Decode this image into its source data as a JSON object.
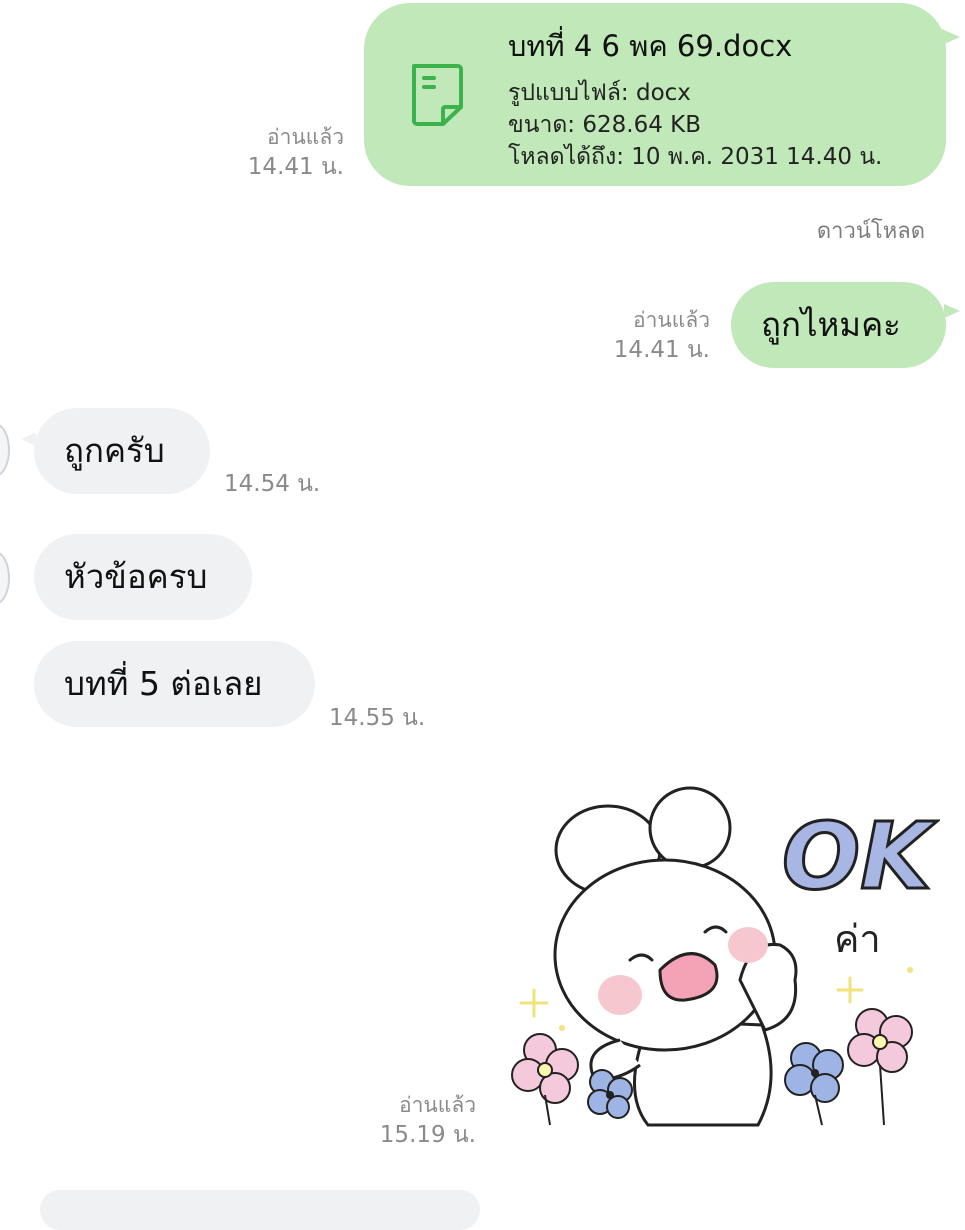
{
  "messages": {
    "file": {
      "name": "บทที่ 4 6 พค 69.docx",
      "type_line": "รูปแบบไฟล์: docx",
      "size_line": "ขนาด: 628.64 KB",
      "expiry_line": "โหลดได้ถึง: 10 พ.ค. 2031 14.40 น.",
      "read": "อ่านแล้ว",
      "time": "14.41 น.",
      "download_label": "ดาวน์โหลด",
      "icon": "document-icon",
      "accent_color": "#3cb24a"
    },
    "outgoing_1": {
      "text": "ถูกไหมคะ",
      "read": "อ่านแล้ว",
      "time": "14.41 น."
    },
    "incoming_1": {
      "text": "ถูกครับ",
      "time": "14.54 น."
    },
    "incoming_2": {
      "text": "หัวข้อครบ"
    },
    "incoming_3": {
      "text": "บทที่ 5 ต่อเลย",
      "time": "14.55 น."
    },
    "sticker": {
      "text_ok": "OK",
      "text_caption": "ค่า",
      "read": "อ่านแล้ว",
      "time": "15.19 น."
    }
  },
  "colors": {
    "outgoing_bubble": "#c0e8b8",
    "incoming_bubble": "#f0f1f3",
    "meta_text": "#8a8a8a"
  }
}
